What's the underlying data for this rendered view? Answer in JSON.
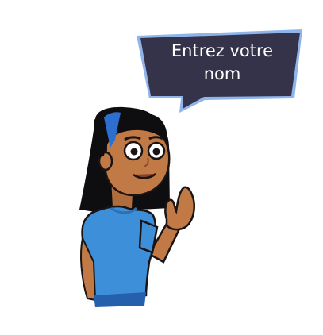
{
  "speech_bubble": {
    "line1": "Entrez votre",
    "line2": "nom"
  },
  "colors": {
    "bubble_fill": "#34334a",
    "bubble_border": "#8fb4ea",
    "shirt": "#3d8fd9",
    "skin": "#c17a45",
    "hair": "#0e0d10",
    "headband": "#2d6fcf"
  }
}
